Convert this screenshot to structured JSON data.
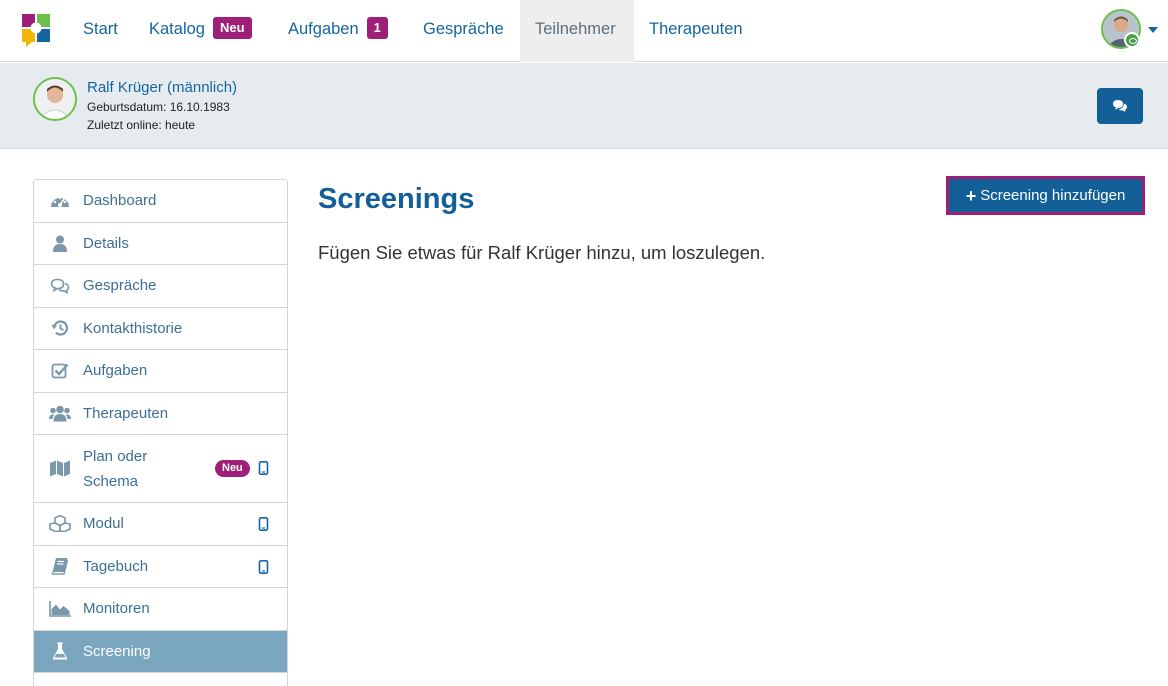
{
  "navbar": {
    "items": [
      {
        "label": "Start"
      },
      {
        "label": "Katalog",
        "badge": "Neu"
      },
      {
        "label": "Aufgaben",
        "badge": "1"
      },
      {
        "label": "Gespräche"
      },
      {
        "label": "Teilnehmer",
        "active": true
      },
      {
        "label": "Therapeuten"
      }
    ]
  },
  "participant": {
    "name": "Ralf Krüger (männlich)",
    "birthdate": "Geburtsdatum: 16.10.1983",
    "last_online": "Zuletzt online: heute"
  },
  "sidebar": {
    "items": [
      {
        "label": "Dashboard",
        "icon": "dashboard-icon"
      },
      {
        "label": "Details",
        "icon": "user-icon"
      },
      {
        "label": "Gespräche",
        "icon": "comments-icon"
      },
      {
        "label": "Kontakthistorie",
        "icon": "history-icon"
      },
      {
        "label": "Aufgaben",
        "icon": "check-square-icon"
      },
      {
        "label": "Therapeuten",
        "icon": "users-icon"
      },
      {
        "label": "Plan oder Schema",
        "icon": "map-icon",
        "badge": "Neu",
        "mobile": true
      },
      {
        "label": "Modul",
        "icon": "cubes-icon",
        "mobile": true
      },
      {
        "label": "Tagebuch",
        "icon": "book-icon",
        "mobile": true
      },
      {
        "label": "Monitoren",
        "icon": "area-chart-icon"
      },
      {
        "label": "Screening",
        "icon": "flask-icon",
        "active": true
      }
    ]
  },
  "main": {
    "title": "Screenings",
    "empty_message": "Fügen Sie etwas für Ralf Krüger hinzu, um loszulegen.",
    "add_button": "Screening hinzufügen"
  },
  "colors": {
    "brand_blue": "#135f98",
    "link_blue": "#16669e",
    "accent_purple": "#9d1f78",
    "active_sidebar": "#7aa6bf",
    "header_bg": "#e5ebef"
  }
}
